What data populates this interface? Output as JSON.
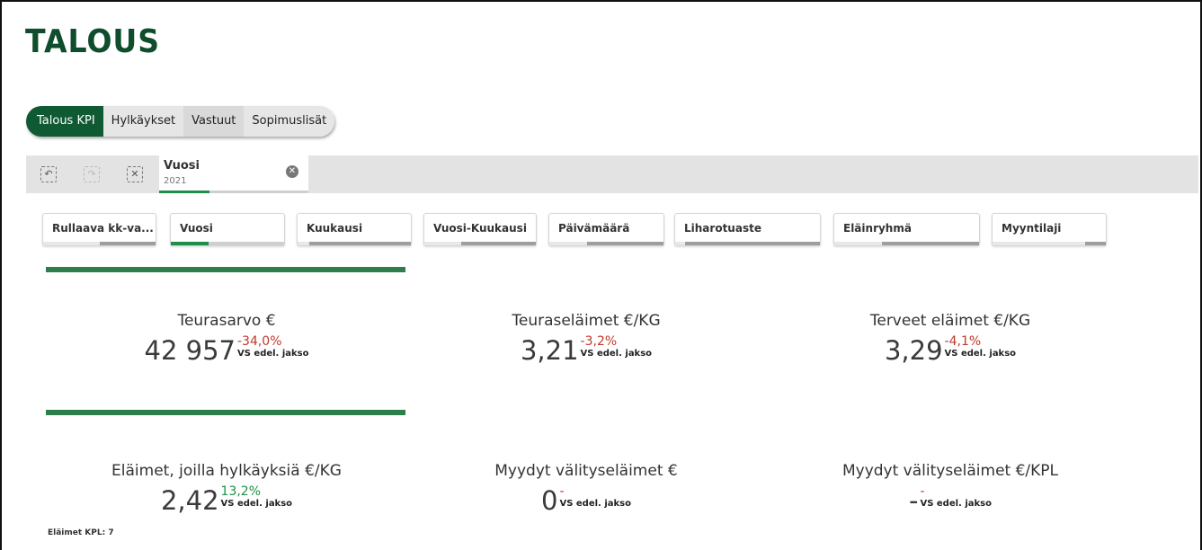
{
  "app": {
    "title": "TALOUS"
  },
  "tabs": [
    {
      "label": "Talous KPI",
      "active": true
    },
    {
      "label": "Hylkäykset",
      "active": false
    },
    {
      "label": "Vastuut",
      "active": false
    },
    {
      "label": "Sopimuslisät",
      "active": false
    }
  ],
  "selections": {
    "tools": [
      "step-back-icon",
      "step-forward-icon",
      "clear-all-icon"
    ],
    "chip": {
      "label": "Vuosi",
      "value": "2021"
    }
  },
  "filters": [
    {
      "label": "Rullaava kk-va...",
      "selected_fraction": 0.5
    },
    {
      "label": "Vuosi",
      "selected_fraction": 0.33
    },
    {
      "label": "Kuukausi",
      "selected_fraction": 0
    },
    {
      "label": "Vuosi-Kuukausi",
      "selected_fraction": 0.33
    },
    {
      "label": "Päivämäärä",
      "selected_fraction": 0.33
    },
    {
      "label": "Liharotuaste",
      "selected_fraction": 0.07
    },
    {
      "label": "Eläinryhmä",
      "selected_fraction": 0.33
    },
    {
      "label": "Myyntilaji",
      "selected_fraction": 0.8
    }
  ],
  "kpis": [
    {
      "title": "Teurasarvo €",
      "value": "42 957",
      "delta": "-34,0%",
      "trend": "neg",
      "vs": "VS edel. jakso"
    },
    {
      "title": "Teuraseläimet €/KG",
      "value": "3,21",
      "delta": "-3,2%",
      "trend": "neg",
      "vs": "VS edel. jakso"
    },
    {
      "title": "Terveet eläimet €/KG",
      "value": "3,29",
      "delta": "-4,1%",
      "trend": "neg",
      "vs": "VS edel. jakso"
    },
    {
      "title": "Eläimet, joilla hylkäyksiä €/KG",
      "value": "2,42",
      "delta": "13,2%",
      "trend": "pos",
      "vs": "VS edel. jakso"
    },
    {
      "title": "Myydyt välityseläimet €",
      "value": "0",
      "delta": "-",
      "trend": "neg",
      "vs": "VS edel. jakso"
    },
    {
      "title": "Myydyt välityseläimet €/KPL",
      "value": "-",
      "delta": "-",
      "trend": "neg",
      "vs": "VS edel. jakso"
    }
  ],
  "footnote": "Eläimet KPL: 7",
  "colors": {
    "brand": "#0f4d2c",
    "accent_green": "#1f8f47",
    "negative": "#c0392b"
  }
}
